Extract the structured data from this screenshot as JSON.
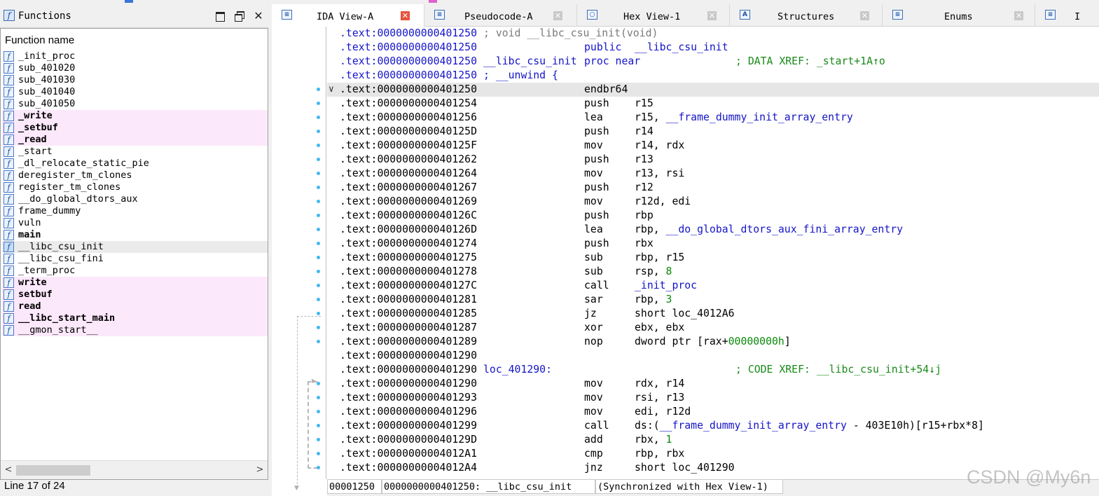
{
  "functions_panel": {
    "title": "Functions",
    "header": "Function name",
    "items": [
      {
        "name": "_init_proc",
        "style": "normal"
      },
      {
        "name": "sub_401020",
        "style": "normal"
      },
      {
        "name": "sub_401030",
        "style": "normal"
      },
      {
        "name": "sub_401040",
        "style": "normal"
      },
      {
        "name": "sub_401050",
        "style": "normal"
      },
      {
        "name": "_write",
        "style": "imported"
      },
      {
        "name": "_setbuf",
        "style": "imported"
      },
      {
        "name": "_read",
        "style": "imported"
      },
      {
        "name": "_start",
        "style": "normal"
      },
      {
        "name": "_dl_relocate_static_pie",
        "style": "normal"
      },
      {
        "name": "deregister_tm_clones",
        "style": "normal"
      },
      {
        "name": "register_tm_clones",
        "style": "normal"
      },
      {
        "name": "__do_global_dtors_aux",
        "style": "normal"
      },
      {
        "name": "frame_dummy",
        "style": "normal"
      },
      {
        "name": "vuln",
        "style": "normal"
      },
      {
        "name": "main",
        "style": "bold"
      },
      {
        "name": "__libc_csu_init",
        "style": "selected"
      },
      {
        "name": "__libc_csu_fini",
        "style": "normal"
      },
      {
        "name": "_term_proc",
        "style": "normal"
      },
      {
        "name": "write",
        "style": "imported"
      },
      {
        "name": "setbuf",
        "style": "imported"
      },
      {
        "name": "read",
        "style": "imported"
      },
      {
        "name": "__libc_start_main",
        "style": "imported"
      },
      {
        "name": "__gmon_start__",
        "style": "imported-normal"
      }
    ],
    "status": "Line 17 of 24"
  },
  "tabs": [
    {
      "label": "IDA View-A",
      "icon": "ida-view-icon",
      "active": true
    },
    {
      "label": "Pseudocode-A",
      "icon": "pseudocode-icon",
      "active": false
    },
    {
      "label": "Hex View-1",
      "icon": "hex-view-icon",
      "active": false
    },
    {
      "label": "Structures",
      "icon": "structures-icon",
      "active": false
    },
    {
      "label": "Enums",
      "icon": "enums-icon",
      "active": false
    },
    {
      "label": "I",
      "icon": "imports-icon",
      "active": false
    }
  ],
  "disassembly": [
    {
      "addr": ".text:0000000000401250",
      "comment": "; void __libc_csu_init(void)",
      "addr_blue": true
    },
    {
      "addr": ".text:0000000000401250",
      "mnemonic": "public",
      "operands": "__libc_csu_init",
      "addr_blue": true,
      "mn_blue": true,
      "ops_blue": true
    },
    {
      "addr": ".text:0000000000401250",
      "label": "__libc_csu_init",
      "mnemonic": "proc near",
      "xref": "; DATA XREF: _start+1A↑o",
      "addr_blue": true,
      "mn_blue": true
    },
    {
      "addr": ".text:0000000000401250",
      "label": "; __unwind {",
      "addr_blue": true
    },
    {
      "addr": ".text:0000000000401250",
      "mnemonic": "endbr64",
      "highlight": true
    },
    {
      "addr": ".text:0000000000401254",
      "mnemonic": "push",
      "operands": "r15"
    },
    {
      "addr": ".text:0000000000401256",
      "mnemonic": "lea",
      "operands": "r15, __frame_dummy_init_array_entry",
      "ops_split": [
        "r15, ",
        "__frame_dummy_init_array_entry"
      ]
    },
    {
      "addr": ".text:000000000040125D",
      "mnemonic": "push",
      "operands": "r14"
    },
    {
      "addr": ".text:000000000040125F",
      "mnemonic": "mov",
      "operands": "r14, rdx"
    },
    {
      "addr": ".text:0000000000401262",
      "mnemonic": "push",
      "operands": "r13"
    },
    {
      "addr": ".text:0000000000401264",
      "mnemonic": "mov",
      "operands": "r13, rsi"
    },
    {
      "addr": ".text:0000000000401267",
      "mnemonic": "push",
      "operands": "r12"
    },
    {
      "addr": ".text:0000000000401269",
      "mnemonic": "mov",
      "operands": "r12d, edi"
    },
    {
      "addr": ".text:000000000040126C",
      "mnemonic": "push",
      "operands": "rbp"
    },
    {
      "addr": ".text:000000000040126D",
      "mnemonic": "lea",
      "operands": "rbp, __do_global_dtors_aux_fini_array_entry",
      "ops_split": [
        "rbp, ",
        "__do_global_dtors_aux_fini_array_entry"
      ]
    },
    {
      "addr": ".text:0000000000401274",
      "mnemonic": "push",
      "operands": "rbx"
    },
    {
      "addr": ".text:0000000000401275",
      "mnemonic": "sub",
      "operands": "rbp, r15"
    },
    {
      "addr": ".text:0000000000401278",
      "mnemonic": "sub",
      "operands": "rsp, 8",
      "ops_split": [
        "rsp, ",
        "8"
      ],
      "ops_num": true
    },
    {
      "addr": ".text:000000000040127C",
      "mnemonic": "call",
      "operands": "_init_proc",
      "ops_split": [
        "",
        "_init_proc"
      ]
    },
    {
      "addr": ".text:0000000000401281",
      "mnemonic": "sar",
      "operands": "rbp, 3",
      "ops_split": [
        "rbp, ",
        "3"
      ],
      "ops_num": true
    },
    {
      "addr": ".text:0000000000401285",
      "mnemonic": "jz",
      "operands": "short loc_4012A6"
    },
    {
      "addr": ".text:0000000000401287",
      "mnemonic": "xor",
      "operands": "ebx, ebx"
    },
    {
      "addr": ".text:0000000000401289",
      "mnemonic": "nop",
      "operands": "dword ptr [rax+00000000h]",
      "ops_split": [
        "dword ptr [rax+",
        "00000000h",
        "]"
      ],
      "ops_num": true
    },
    {
      "addr": ".text:0000000000401290"
    },
    {
      "addr": ".text:0000000000401290",
      "label": "loc_401290:",
      "xref": "; CODE XREF: __libc_csu_init+54↓j"
    },
    {
      "addr": ".text:0000000000401290",
      "mnemonic": "mov",
      "operands": "rdx, r14"
    },
    {
      "addr": ".text:0000000000401293",
      "mnemonic": "mov",
      "operands": "rsi, r13"
    },
    {
      "addr": ".text:0000000000401296",
      "mnemonic": "mov",
      "operands": "edi, r12d"
    },
    {
      "addr": ".text:0000000000401299",
      "mnemonic": "call",
      "operands": "ds:(__frame_dummy_init_array_entry - 403E10h)[r15+rbx*8]",
      "ops_split": [
        "ds:(",
        "__frame_dummy_init_array_entry",
        " - 403E10h)[r15+rbx*8]"
      ]
    },
    {
      "addr": ".text:000000000040129D",
      "mnemonic": "add",
      "operands": "rbx, 1",
      "ops_split": [
        "rbx, ",
        "1"
      ],
      "ops_num": true
    },
    {
      "addr": ".text:00000000004012A1",
      "mnemonic": "cmp",
      "operands": "rbp, rbx"
    },
    {
      "addr": ".text:00000000004012A4",
      "mnemonic": "jnz",
      "operands": "short loc_401290"
    }
  ],
  "status_bar": {
    "offset": "00001250",
    "location": "0000000000401250: __libc_csu_init",
    "sync": "(Synchronized with Hex View-1)"
  },
  "watermark": "CSDN @My6n",
  "colors": {
    "imported_bg": "#fce8fb",
    "selected_bg": "#ebebeb",
    "code_blue": "#1414c8",
    "xref_green": "#1a8a1a",
    "number_green": "#0a8a0a",
    "comment_gray": "#7a7a7a",
    "gutter_dot": "#43b7f0",
    "active_close": "#e5543f"
  }
}
